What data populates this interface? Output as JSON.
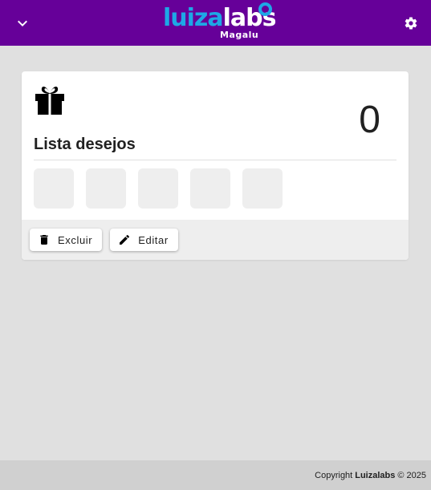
{
  "header": {
    "menu_icon": "chevron-down-icon",
    "settings_icon": "gear-icon",
    "logo": {
      "word_a": "luiza",
      "word_b": "labs",
      "sub": "Magalu"
    },
    "background_color": "#660099",
    "accent_color": "#1ea7e6"
  },
  "card": {
    "icon": "gift-icon",
    "count": "0",
    "title": "Lista desejos",
    "thumbnails": 5,
    "actions": {
      "delete_label": "Excluir",
      "delete_icon": "trash-icon",
      "edit_label": "Editar",
      "edit_icon": "pencil-icon"
    }
  },
  "footer": {
    "prefix": "Copyright",
    "brand": "Luizalabs",
    "suffix": "© 2025"
  }
}
